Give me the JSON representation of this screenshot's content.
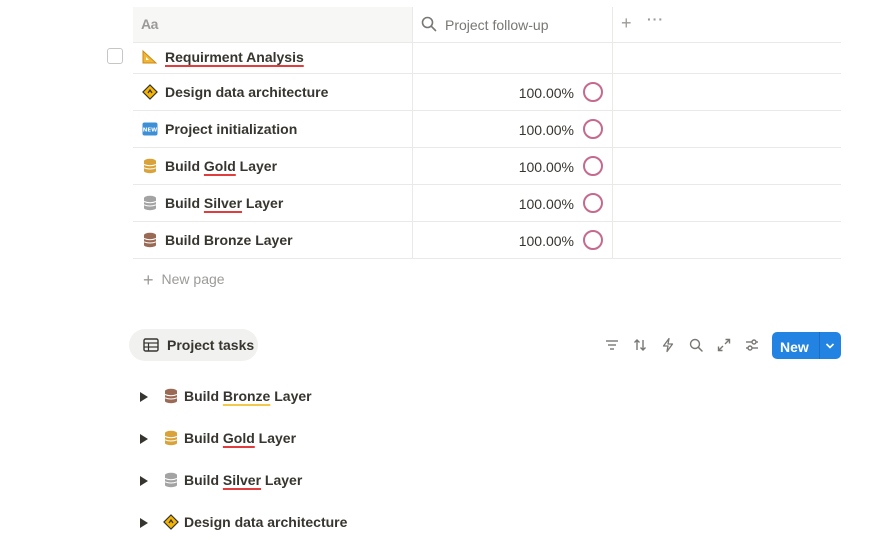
{
  "table": {
    "header": {
      "name_icon": "Aa",
      "prop_label": "Project follow-up",
      "add": "+",
      "more": "···"
    },
    "rows": [
      {
        "title": "Requirment Analysis",
        "icon": "triangle-ruler-icon",
        "percent": ""
      },
      {
        "title": "Design data architecture",
        "icon": "diamond-sign-icon",
        "percent": "100.00%"
      },
      {
        "title": "Project initialization",
        "icon": "new-badge-icon",
        "percent": "100.00%"
      },
      {
        "title": "Build Gold Layer",
        "icon": "database-gold-icon",
        "percent": "100.00%"
      },
      {
        "title": "Build Silver Layer",
        "icon": "database-silver-icon",
        "percent": "100.00%"
      },
      {
        "title": "Build Bronze Layer",
        "icon": "database-bronze-icon",
        "percent": "100.00%"
      }
    ],
    "new_page": "New page"
  },
  "tasks_view": {
    "tab_label": "Project tasks",
    "new_label": "New",
    "items": [
      {
        "title": "Build Bronze Layer",
        "icon": "database-bronze-icon"
      },
      {
        "title": "Build Gold Layer",
        "icon": "database-gold-icon"
      },
      {
        "title": "Build Silver Layer",
        "icon": "database-silver-icon"
      },
      {
        "title": "Design data architecture",
        "icon": "diamond-sign-icon"
      }
    ]
  },
  "colors": {
    "accent": "#2383e2",
    "progress_ring": "#c56a8e",
    "gold": "#d9a33a",
    "silver": "#a3a3a3",
    "bronze": "#9b6a55"
  }
}
